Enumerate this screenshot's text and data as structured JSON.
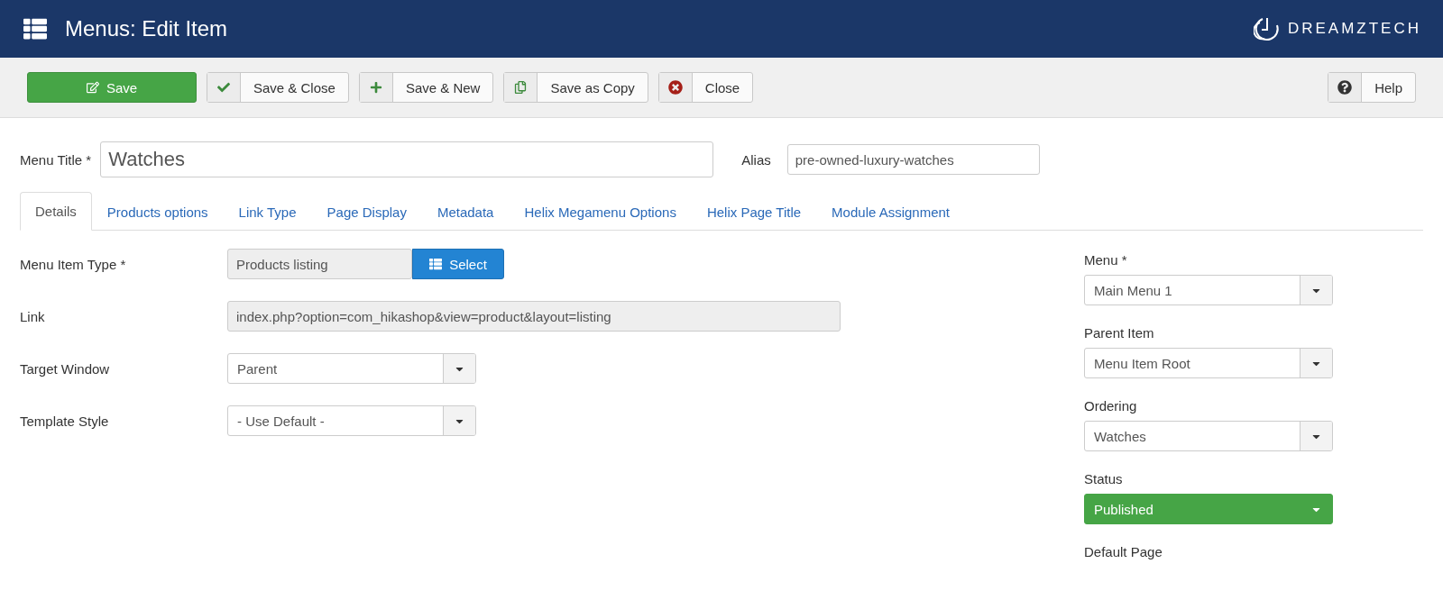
{
  "header": {
    "title": "Menus: Edit Item",
    "logo": "DREAMZTECH"
  },
  "toolbar": {
    "buttons": [
      {
        "kind": "primary",
        "label": "Save"
      },
      {
        "kind": "default",
        "label": "Save & Close"
      },
      {
        "kind": "default",
        "label": "Save & New"
      },
      {
        "kind": "default",
        "label": "Save as Copy"
      },
      {
        "kind": "default",
        "label": "Close"
      }
    ],
    "help": {
      "label": "Help"
    }
  },
  "title_row": {
    "label": "Menu Title *",
    "value": "Watches",
    "alias_label": "Alias",
    "alias_value": "pre-owned-luxury-watches"
  },
  "tabs": [
    {
      "label": "Details",
      "selected": true
    },
    {
      "label": "Products options",
      "selected": false
    },
    {
      "label": "Link Type",
      "selected": false
    },
    {
      "label": "Page Display",
      "selected": false
    },
    {
      "label": "Metadata",
      "selected": false
    },
    {
      "label": "Helix Megamenu Options",
      "selected": false
    },
    {
      "label": "Helix Page Title",
      "selected": false
    },
    {
      "label": "Module Assignment",
      "selected": false
    }
  ],
  "fields": [
    {
      "kind": "chooser",
      "label": "Menu Item Type *",
      "value": "Products listing",
      "button": "Select"
    },
    {
      "kind": "readonly",
      "label": "Link",
      "value": "index.php?option=com_hikashop&view=product&layout=listing"
    },
    {
      "kind": "select",
      "label": "Target Window",
      "value": "Parent"
    },
    {
      "kind": "select",
      "label": "Template Style",
      "value": "- Use Default -"
    }
  ],
  "side_fields": [
    {
      "kind": "select",
      "label": "Menu *",
      "value": "Main Menu 1"
    },
    {
      "kind": "select",
      "label": "Parent Item",
      "value": "Menu Item Root"
    },
    {
      "kind": "select",
      "label": "Ordering",
      "value": "Watches"
    },
    {
      "kind": "status",
      "label": "Status",
      "value": "Published"
    },
    {
      "kind": "label",
      "label": "Default Page"
    }
  ]
}
